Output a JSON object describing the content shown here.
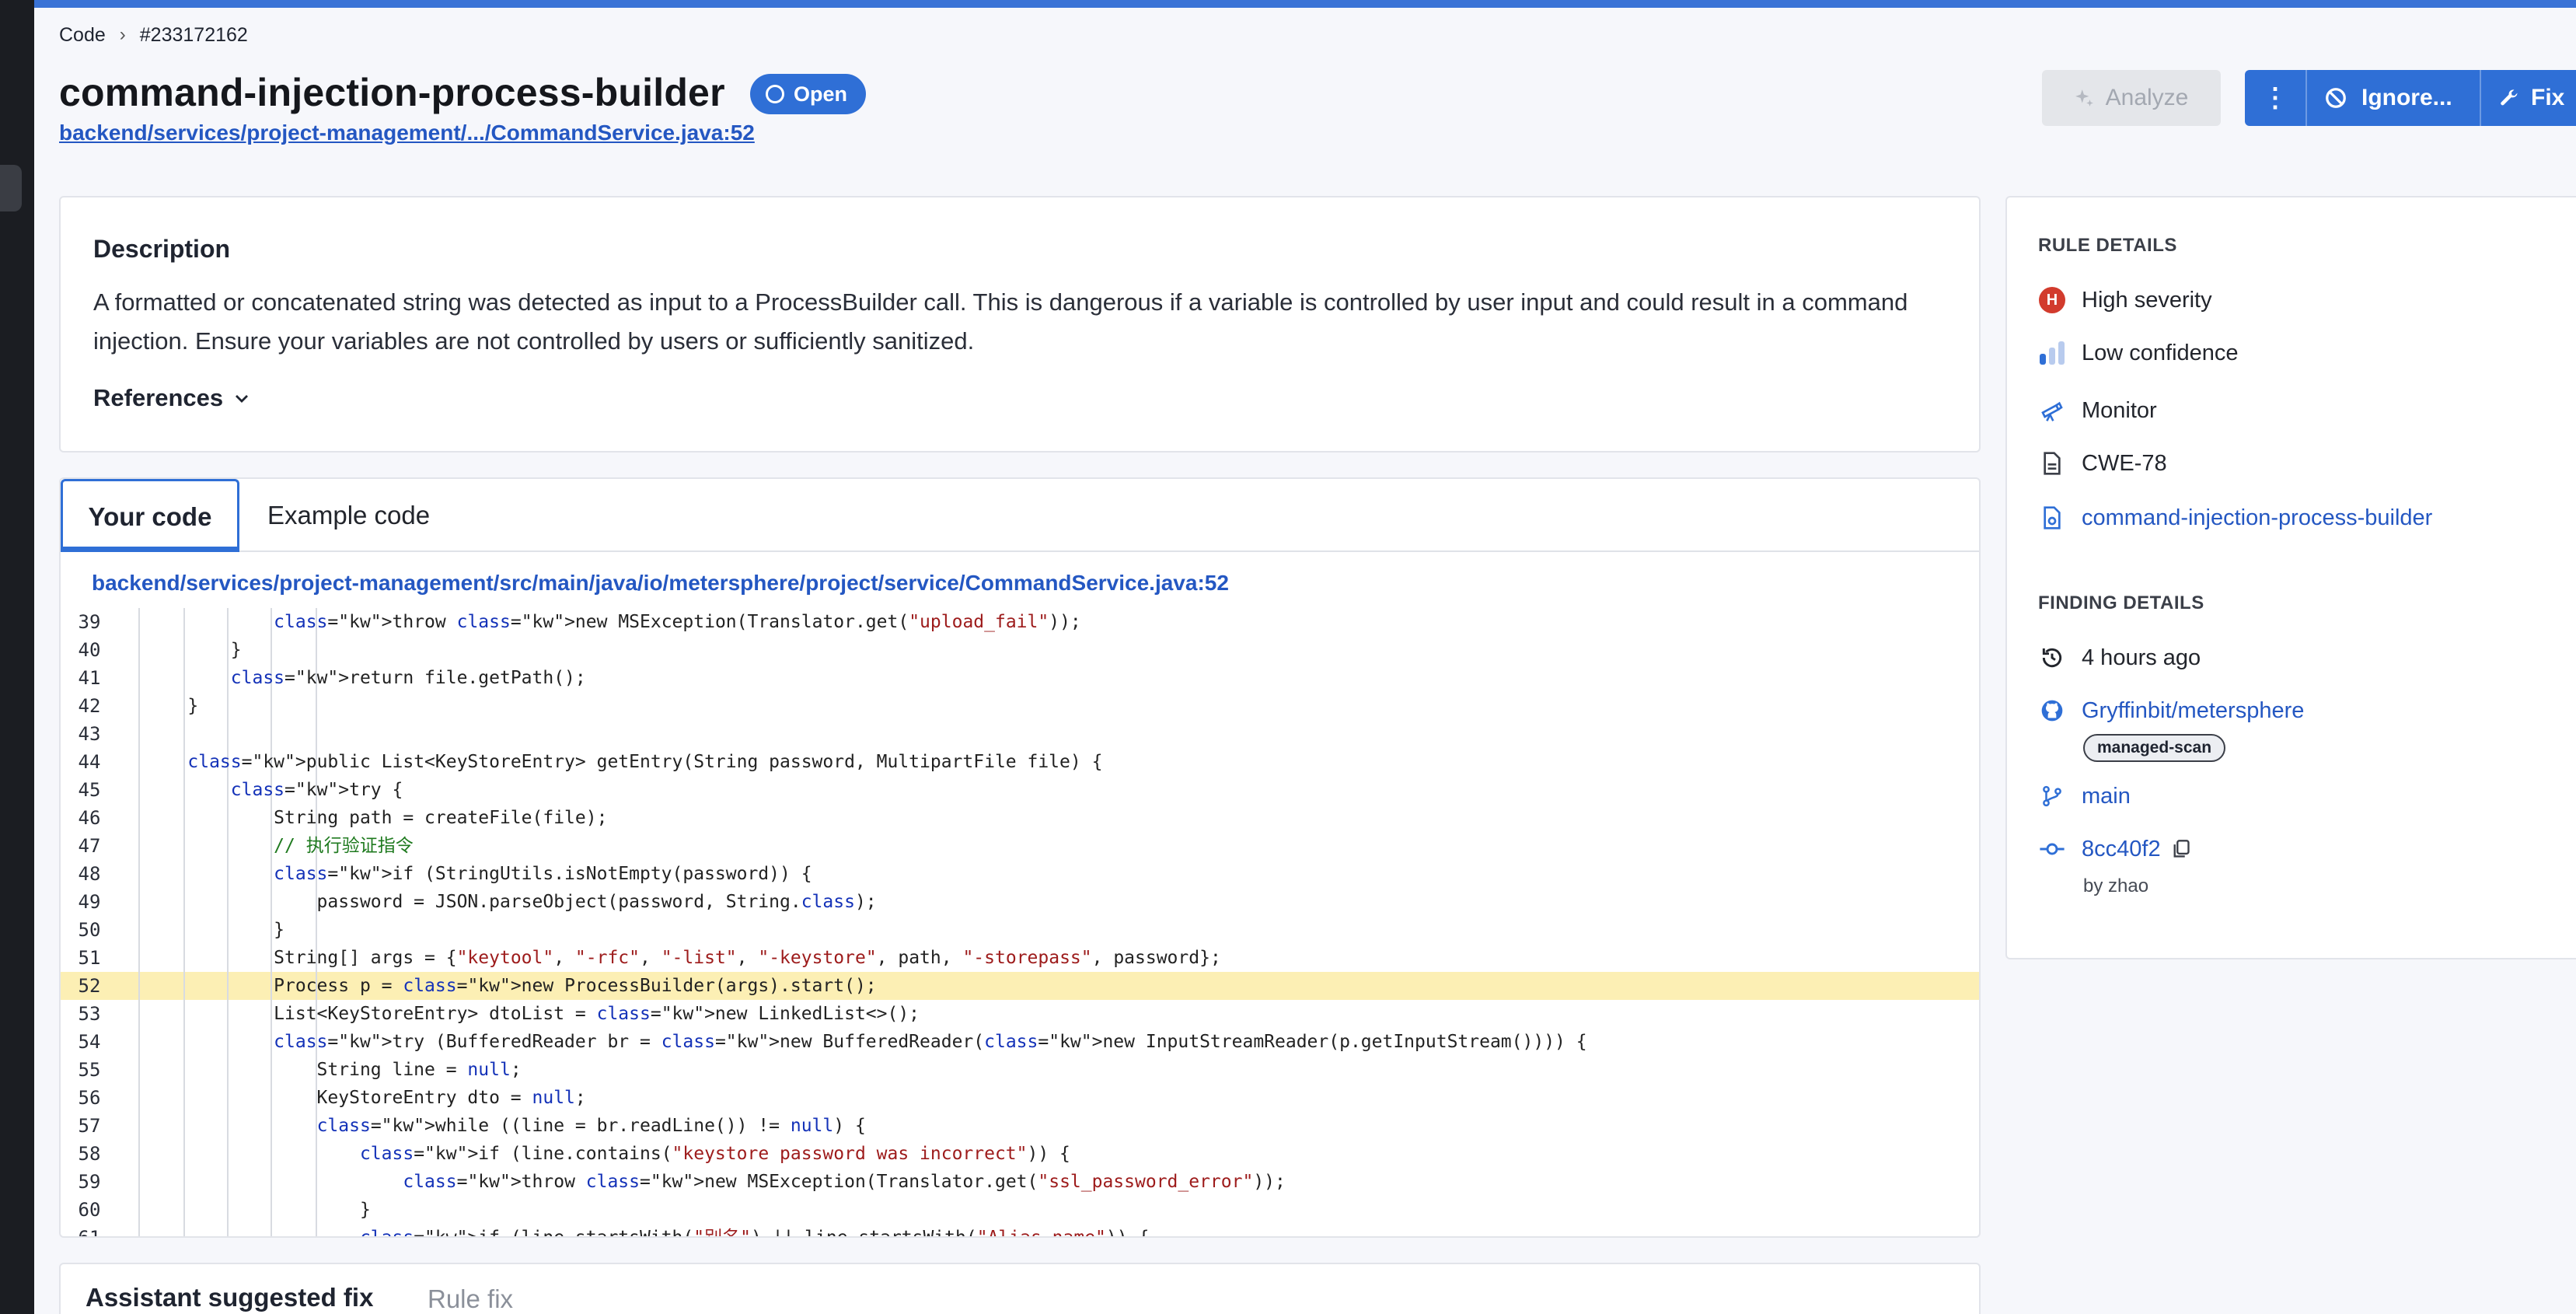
{
  "breadcrumb": {
    "root": "Code",
    "id": "#233172162"
  },
  "finding": {
    "title": "command-injection-process-builder",
    "status": "Open",
    "file_link": "backend/services/project-management/.../CommandService.java:52"
  },
  "actions": {
    "analyze": "Analyze",
    "more_icon": "kebab-menu-icon",
    "ignore": "Ignore...",
    "fix": "Fix"
  },
  "description": {
    "heading": "Description",
    "text": "A formatted or concatenated string was detected as input to a ProcessBuilder call. This is dangerous if a variable is controlled by user input and could result in a command injection. Ensure your variables are not controlled by users or sufficiently sanitized.",
    "references": "References"
  },
  "tabs": {
    "your_code": "Your code",
    "example_code": "Example code"
  },
  "code": {
    "path": "backend/services/project-management/src/main/java/io/metersphere/project/service/CommandService.java:52",
    "highlighted_line": 52,
    "lines": [
      {
        "n": "39",
        "text": "            throw new MSException(Translator.get(\"upload_fail\"));"
      },
      {
        "n": "40",
        "text": "        }"
      },
      {
        "n": "41",
        "text": "        return file.getPath();"
      },
      {
        "n": "42",
        "text": "    }"
      },
      {
        "n": "43",
        "text": ""
      },
      {
        "n": "44",
        "text": "    public List<KeyStoreEntry> getEntry(String password, MultipartFile file) {"
      },
      {
        "n": "45",
        "text": "        try {"
      },
      {
        "n": "46",
        "text": "            String path = createFile(file);"
      },
      {
        "n": "47",
        "text": "            // 执行验证指令"
      },
      {
        "n": "48",
        "text": "            if (StringUtils.isNotEmpty(password)) {"
      },
      {
        "n": "49",
        "text": "                password = JSON.parseObject(password, String.class);"
      },
      {
        "n": "50",
        "text": "            }"
      },
      {
        "n": "51",
        "text": "            String[] args = {\"keytool\", \"-rfc\", \"-list\", \"-keystore\", path, \"-storepass\", password};"
      },
      {
        "n": "52",
        "text": "            Process p = new ProcessBuilder(args).start();"
      },
      {
        "n": "53",
        "text": "            List<KeyStoreEntry> dtoList = new LinkedList<>();"
      },
      {
        "n": "54",
        "text": "            try (BufferedReader br = new BufferedReader(new InputStreamReader(p.getInputStream()))) {"
      },
      {
        "n": "55",
        "text": "                String line = null;"
      },
      {
        "n": "56",
        "text": "                KeyStoreEntry dto = null;"
      },
      {
        "n": "57",
        "text": "                while ((line = br.readLine()) != null) {"
      },
      {
        "n": "58",
        "text": "                    if (line.contains(\"keystore password was incorrect\")) {"
      },
      {
        "n": "59",
        "text": "                        throw new MSException(Translator.get(\"ssl_password_error\"));"
      },
      {
        "n": "60",
        "text": "                    }"
      },
      {
        "n": "61",
        "text": "                    if (line.startsWith(\"别名\") || line.startsWith(\"Alias name\")) {"
      }
    ]
  },
  "assistant": {
    "title": "Assistant suggested fix",
    "rule_fix": "Rule fix"
  },
  "rule_details": {
    "heading": "RULE DETAILS",
    "severity": "High severity",
    "severity_letter": "H",
    "confidence": "Low confidence",
    "mode": "Monitor",
    "cwe": "CWE-78",
    "rule": "command-injection-process-builder"
  },
  "finding_details": {
    "heading": "FINDING DETAILS",
    "time": "4 hours ago",
    "repo": "Gryffinbit/metersphere",
    "repo_tag": "managed-scan",
    "branch": "main",
    "commit": "8cc40f2",
    "author": "by zhao"
  },
  "colors": {
    "accent": "#2f6fd6",
    "severity_high": "#d23b2d",
    "highlight": "#fcefb4"
  }
}
